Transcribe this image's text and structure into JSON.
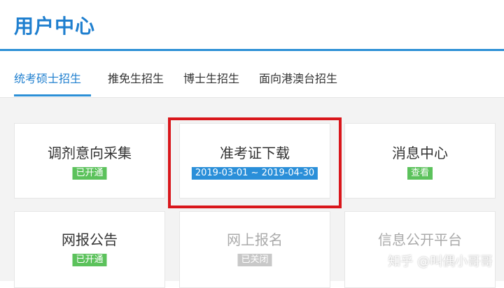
{
  "header": {
    "title": "用户中心"
  },
  "tabs": [
    {
      "label": "统考硕士招生",
      "active": true
    },
    {
      "label": "推免生招生",
      "active": false
    },
    {
      "label": "博士生招生",
      "active": false
    },
    {
      "label": "面向港澳台招生",
      "active": false
    }
  ],
  "cards": [
    {
      "title": "调剂意向采集",
      "badge": "已开通",
      "status": "green"
    },
    {
      "title": "准考证下载",
      "badge": "2019-03-01 ~ 2019-04-30",
      "status": "blue"
    },
    {
      "title": "消息中心",
      "badge": "查看",
      "status": "green"
    },
    {
      "title": "网报公告",
      "badge": "已开通",
      "status": "green"
    },
    {
      "title": "网上报名",
      "badge": "已关闭",
      "status": "gray"
    },
    {
      "title": "信息公开平台",
      "badge": "",
      "status": "gray"
    }
  ],
  "watermark": {
    "text": "知乎 @叫偶小哥哥"
  },
  "colors": {
    "accent": "#2b8fd6",
    "highlight": "#d9161b",
    "green": "#5cc25c",
    "gray": "#c8c8c8"
  }
}
